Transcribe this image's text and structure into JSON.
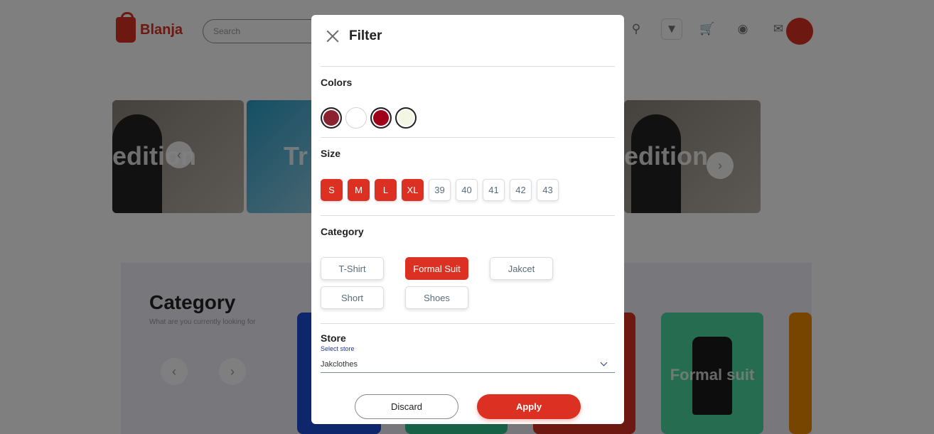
{
  "app": {
    "logo_text": "Blanja",
    "search_placeholder": "Search"
  },
  "banners": [
    {
      "text": "edition"
    },
    {
      "text": "Tr"
    },
    {
      "text": "edition"
    }
  ],
  "background_category": {
    "title": "Category",
    "subtitle": "What are you currently looking for",
    "card_label": "Formal suit"
  },
  "filter": {
    "title": "Filter",
    "colors": {
      "label": "Colors",
      "swatches": [
        {
          "name": "maroon",
          "hex": "#8b2230",
          "selected": true
        },
        {
          "name": "white",
          "hex": "#ffffff",
          "selected": false
        },
        {
          "name": "red",
          "hex": "#a0001a",
          "selected": true
        },
        {
          "name": "cream",
          "hex": "#f4f6e4",
          "selected": true
        }
      ]
    },
    "size": {
      "label": "Size",
      "options": [
        {
          "label": "S",
          "selected": true
        },
        {
          "label": "M",
          "selected": true
        },
        {
          "label": "L",
          "selected": true
        },
        {
          "label": "XL",
          "selected": true
        },
        {
          "label": "39",
          "selected": false
        },
        {
          "label": "40",
          "selected": false
        },
        {
          "label": "41",
          "selected": false
        },
        {
          "label": "42",
          "selected": false
        },
        {
          "label": "43",
          "selected": false
        }
      ]
    },
    "category": {
      "label": "Category",
      "options": [
        {
          "label": "T-Shirt",
          "selected": false
        },
        {
          "label": "Formal Suit",
          "selected": true
        },
        {
          "label": "Jakcet",
          "selected": false
        },
        {
          "label": "Short",
          "selected": false
        },
        {
          "label": "Shoes",
          "selected": false
        }
      ]
    },
    "store": {
      "label": "Store",
      "select_label": "Select store",
      "value": "Jakclothes"
    },
    "buttons": {
      "discard": "Discard",
      "apply": "Apply"
    }
  },
  "colors": {
    "accent": "#db3022",
    "overlay": "rgba(0,0,0,0.5)"
  }
}
